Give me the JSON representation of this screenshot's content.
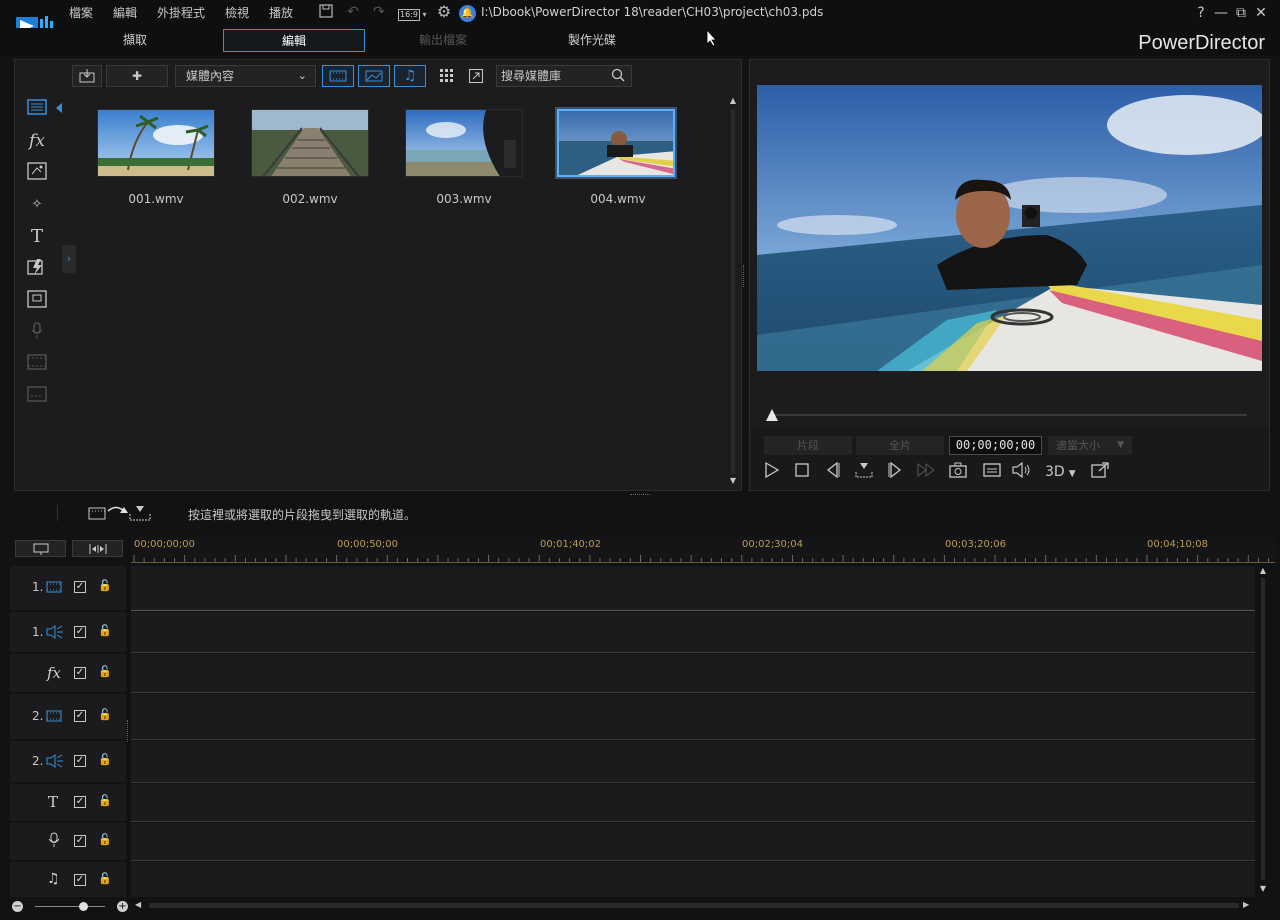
{
  "menu": [
    "檔案",
    "編輯",
    "外掛程式",
    "檢視",
    "播放"
  ],
  "aspect_ratio": "16:9",
  "project_path": "I:\\Dbook\\PowerDirector 18\\reader\\CH03\\project\\ch03.pds",
  "window_controls": {
    "help": "?",
    "minimize": "—",
    "restore": "⧉",
    "close": "✕"
  },
  "modes": [
    {
      "label": "擷取",
      "state": "normal"
    },
    {
      "label": "編輯",
      "state": "active"
    },
    {
      "label": "輸出檔案",
      "state": "disabled"
    },
    {
      "label": "製作光碟",
      "state": "normal"
    }
  ],
  "brand": "PowerDirector",
  "library": {
    "dropdown_value": "媒體內容",
    "search_placeholder": "搜尋媒體庫",
    "media": [
      {
        "label": "001.wmv",
        "selected": false
      },
      {
        "label": "002.wmv",
        "selected": false
      },
      {
        "label": "003.wmv",
        "selected": false
      },
      {
        "label": "004.wmv",
        "selected": true
      }
    ]
  },
  "preview": {
    "clip_label": "片段",
    "full_label": "全片",
    "timecode": "00;00;00;00",
    "fit_label": "適當大小",
    "threed_label": "3D"
  },
  "timeline": {
    "hint": "按這裡或將選取的片段拖曳到選取的軌道。",
    "ruler": [
      "00;00;00;00",
      "00;00;50;00",
      "00;01;40;02",
      "00;02;30;04",
      "00;03;20;06",
      "00;04;10;08"
    ],
    "tracks": [
      {
        "num": "1.",
        "type": "video"
      },
      {
        "num": "1.",
        "type": "audio"
      },
      {
        "num": "",
        "type": "fx"
      },
      {
        "num": "2.",
        "type": "video"
      },
      {
        "num": "2.",
        "type": "audio"
      },
      {
        "num": "",
        "type": "title"
      },
      {
        "num": "",
        "type": "voice"
      },
      {
        "num": "",
        "type": "music"
      }
    ]
  },
  "colors": {
    "accent": "#3a8fd8",
    "ruler_text": "#b89a55",
    "background": "#111214"
  }
}
